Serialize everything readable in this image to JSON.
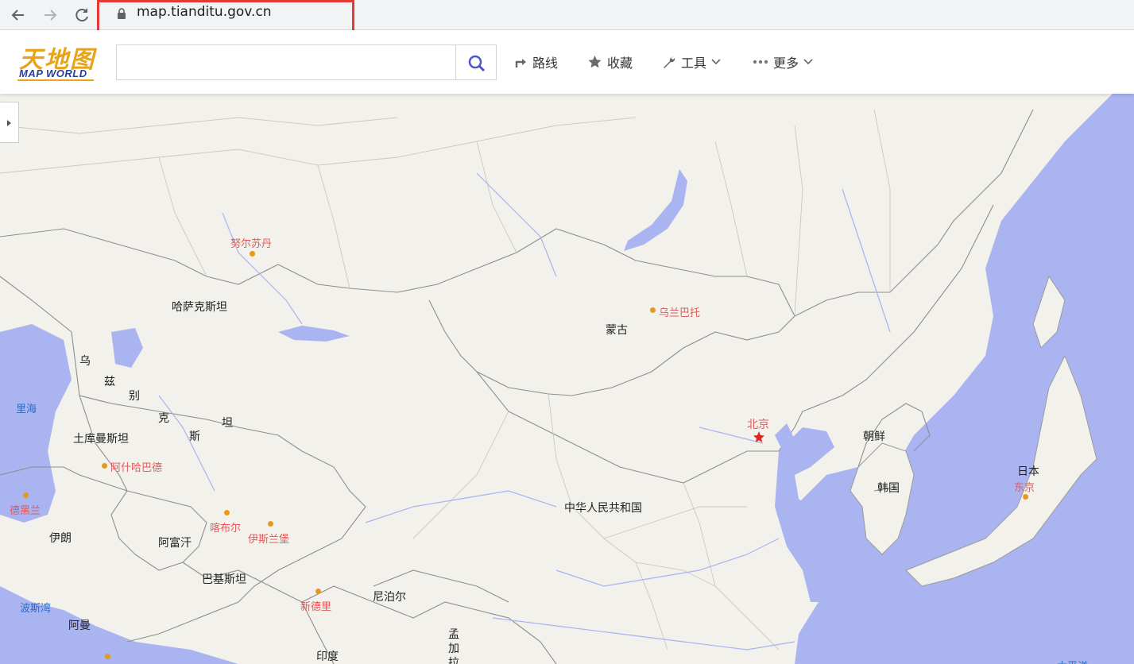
{
  "browser": {
    "url": "map.tianditu.gov.cn"
  },
  "logo": {
    "cn": "天地图",
    "en": "MAP WORLD"
  },
  "search": {
    "placeholder": ""
  },
  "menu": {
    "route": "路线",
    "favorites": "收藏",
    "tools": "工具",
    "more": "更多"
  },
  "map": {
    "countries": {
      "kazakhstan": "哈萨克斯坦",
      "mongolia": "蒙古",
      "china": "中华人民共和国",
      "uzb1": "乌",
      "uzb2": "兹",
      "uzb3": "别",
      "uzb4": "克",
      "uzb5": "斯",
      "uzb6": "坦",
      "turkmenistan": "土库曼斯坦",
      "iran": "伊朗",
      "afghanistan": "阿富汗",
      "pakistan": "巴基斯坦",
      "nepal": "尼泊尔",
      "india": "印度",
      "oman": "阿曼",
      "northkorea": "朝鲜",
      "southkorea": "韩国",
      "japan": "日本",
      "bangla1": "孟",
      "bangla2": "加",
      "bangla3": "拉"
    },
    "cities": {
      "nursultan": "努尔苏丹",
      "ulaanbaatar": "乌兰巴托",
      "beijing": "北京",
      "ashgabat": "阿什哈巴德",
      "tehran": "德黑兰",
      "kabul": "喀布尔",
      "islamabad": "伊斯兰堡",
      "newdelhi": "新德里",
      "tokyo": "东京"
    },
    "seas": {
      "caspian": "里海",
      "persian": "波斯湾",
      "pacific": "太平洋"
    }
  },
  "colors": {
    "land": "#f2f1ec",
    "water": "#aab4f1",
    "border": "#8e8e8e",
    "river": "#a9b4f3",
    "accent": "#e8a317",
    "brand_blue": "#2a3e9c",
    "city_text": "#e05a5a"
  }
}
